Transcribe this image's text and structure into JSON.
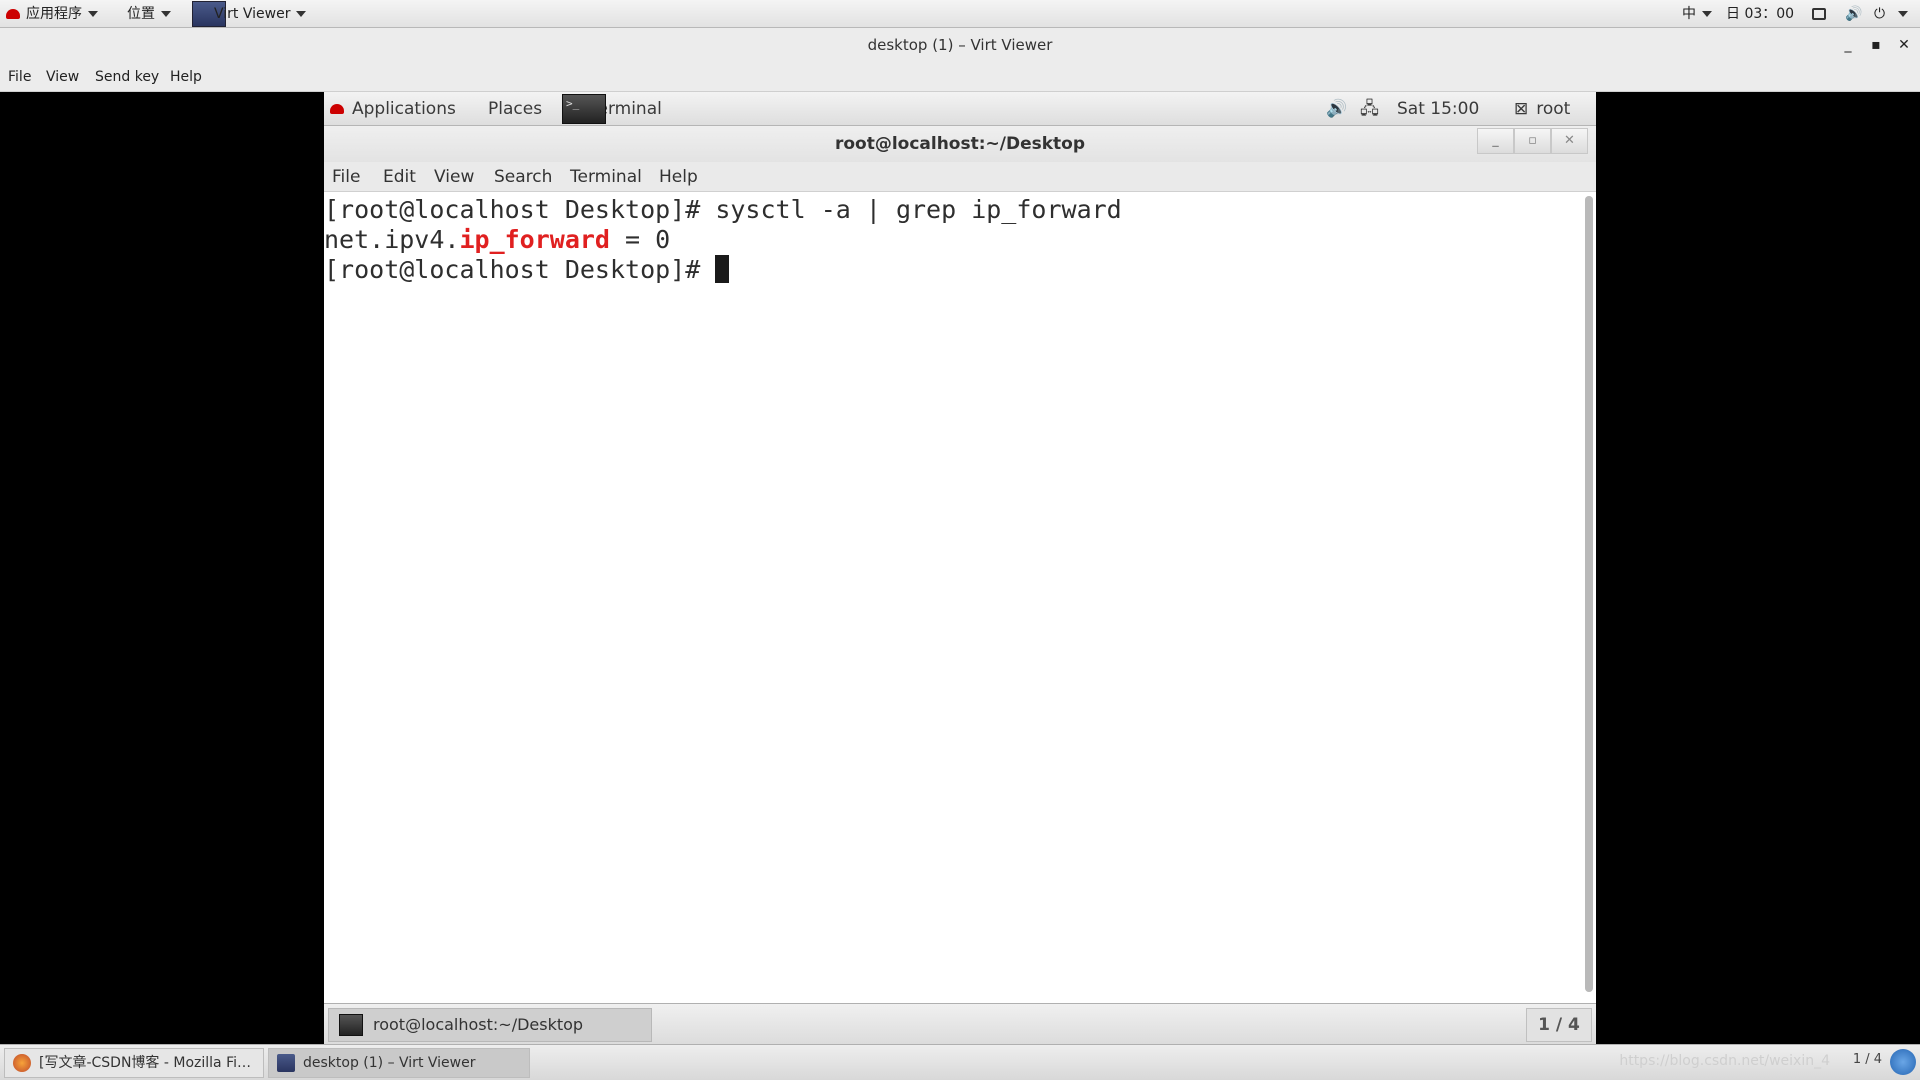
{
  "host_panel": {
    "applications": "应用程序",
    "places": "位置",
    "active_app": "Virt Viewer",
    "input_method": "中",
    "clock": "日 03：00"
  },
  "host_window": {
    "title": "desktop (1) – Virt Viewer",
    "menu": [
      "File",
      "View",
      "Send key",
      "Help"
    ]
  },
  "guest_panel": {
    "applications": "Applications",
    "places": "Places",
    "active_app": "Terminal",
    "clock": "Sat 15:00",
    "user": "root"
  },
  "terminal": {
    "title": "root@localhost:~/Desktop",
    "menu": [
      "File",
      "Edit",
      "View",
      "Search",
      "Terminal",
      "Help"
    ],
    "lines": {
      "l1": "[root@localhost Desktop]# sysctl -a | grep ip_forward",
      "l2_prefix": "net.ipv4.",
      "l2_match": "ip_forward",
      "l2_suffix": " = 0",
      "l3": "[root@localhost Desktop]# "
    }
  },
  "guest_taskbar": {
    "task_label": "root@localhost:~/Desktop",
    "workspace": "1 / 4"
  },
  "host_taskbar": {
    "tasks": [
      {
        "label": "[写文章-CSDN博客 - Mozilla Fi…"
      },
      {
        "label": "desktop (1) – Virt Viewer"
      }
    ],
    "watermark": "https://blog.csdn.net/weixin_4",
    "pager": "1 / 4"
  },
  "colors": {
    "match_highlight": "#e02020",
    "terminal_bg": "#ffffff"
  }
}
